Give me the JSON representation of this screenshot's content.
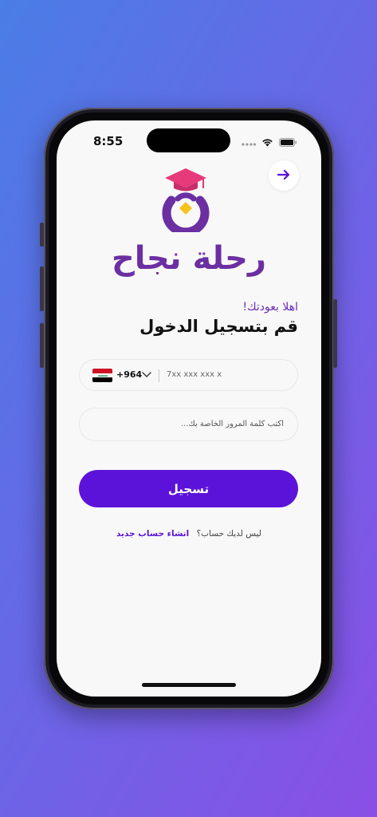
{
  "status_bar": {
    "time": "8:55"
  },
  "header": {
    "back_icon": "arrow-right-icon"
  },
  "logo": {
    "icon": "graduation-cap-ring-icon",
    "text": "رحلة نجاح",
    "colors": {
      "primary": "#6b2fa2",
      "accent": "#f6c21c",
      "cap": "#e63a7a"
    }
  },
  "login": {
    "welcome": "اهلا بعودتك!",
    "title": "قم بتسجيل الدخول"
  },
  "phone_field": {
    "country_flag": "iraq-flag-icon",
    "dial_code": "+964",
    "placeholder": "7xx xxx xxx x"
  },
  "password_field": {
    "placeholder": "اكتب كلمة المرور الخاصة بك..."
  },
  "submit": {
    "label": "تسجيل",
    "color": "#5b13d9"
  },
  "signup": {
    "question": "ليس لديك حساب؟",
    "link": "انشاء حساب جديد"
  }
}
